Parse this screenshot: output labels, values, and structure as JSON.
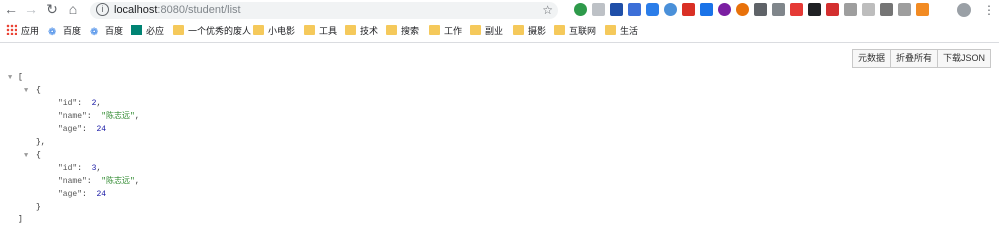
{
  "browser": {
    "url_host": "localhost",
    "url_rest": ":8080/student/list",
    "colors": {
      "bookmark_folder": "#f5c95b",
      "accent_blue": "#1a73e8"
    },
    "extensions": [
      "ext-1",
      "ext-2",
      "ext-3",
      "ext-4",
      "ext-5",
      "ext-6",
      "ext-7",
      "ext-8",
      "ext-9",
      "ext-10",
      "ext-11",
      "ext-12",
      "ext-13",
      "ext-14",
      "ext-15",
      "ext-16",
      "ext-17",
      "ext-18",
      "ext-19",
      "ext-20",
      "ext-21",
      "ext-22",
      "ext-23"
    ]
  },
  "bookmarks": {
    "apps": "应用",
    "items": [
      "百度",
      "百度",
      "必应",
      "一个优秀的废人",
      "小电影",
      "工具",
      "技术",
      "搜索",
      "工作",
      "副业",
      "摄影",
      "互联网",
      "生活"
    ]
  },
  "json_viewer": {
    "buttons": [
      "元数据",
      "折叠所有",
      "下载JSON"
    ],
    "records": [
      {
        "id": "2",
        "name": "\"陈志远\"",
        "age": "24"
      },
      {
        "id": "3",
        "name": "\"陈志远\"",
        "age": "24"
      }
    ],
    "keys": {
      "id": "\"id\"",
      "name": "\"name\"",
      "age": "\"age\""
    },
    "open_bracket": "[",
    "close_bracket": "]",
    "open_brace": "{",
    "close_brace": "}",
    "close_brace_comma": "},",
    "colon": ":",
    "comma": ","
  }
}
